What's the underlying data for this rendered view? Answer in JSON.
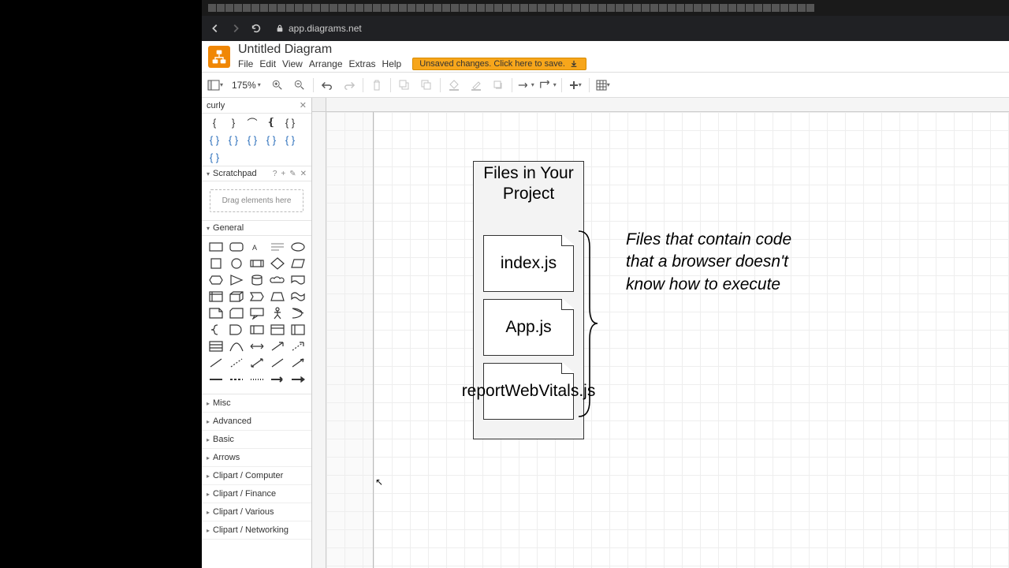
{
  "browser": {
    "url": "app.diagrams.net"
  },
  "app": {
    "title": "Untitled Diagram",
    "menu": [
      "File",
      "Edit",
      "View",
      "Arrange",
      "Extras",
      "Help"
    ],
    "unsaved_warning": "Unsaved changes. Click here to save."
  },
  "toolbar": {
    "zoom": "175%"
  },
  "sidebar": {
    "search_value": "curly",
    "scratchpad": {
      "label": "Scratchpad",
      "hint": "Drag elements here"
    },
    "general": {
      "label": "General"
    },
    "categories": [
      "Misc",
      "Advanced",
      "Basic",
      "Arrows",
      "Clipart / Computer",
      "Clipart / Finance",
      "Clipart / Various",
      "Clipart / Networking"
    ]
  },
  "diagram": {
    "container_title": "Files in Your Project",
    "file1": "index.js",
    "file2": "App.js",
    "file3": "reportWebVitals.js",
    "annotation": "Files that contain code that a browser doesn't know how to execute"
  }
}
